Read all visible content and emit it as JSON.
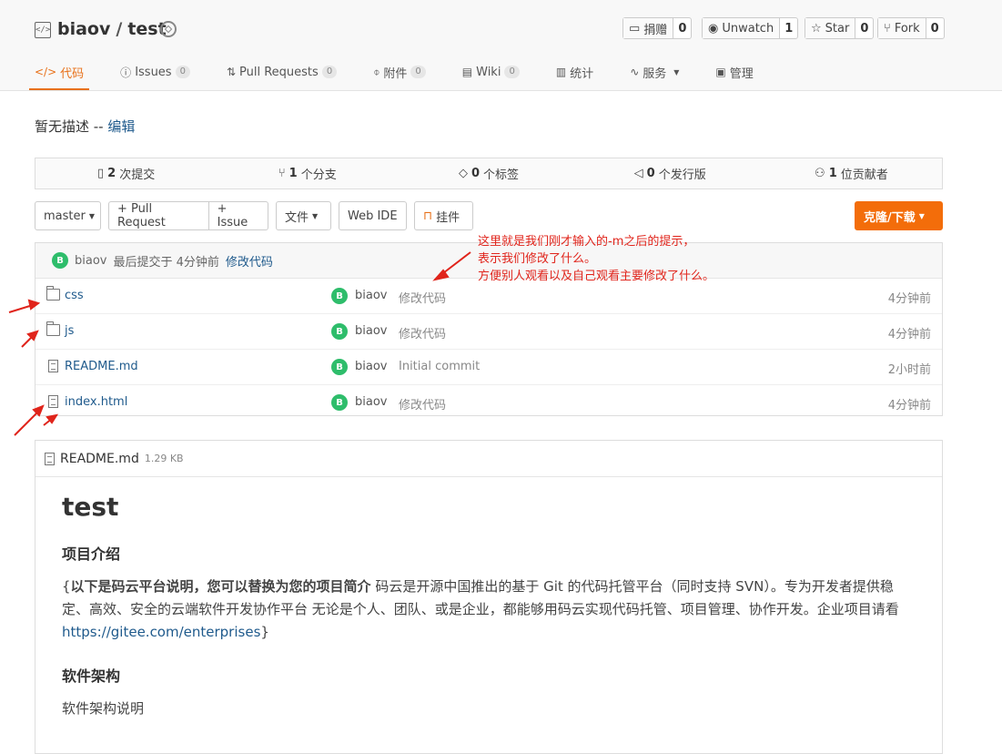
{
  "header": {
    "owner": "biaov",
    "sep": "/",
    "repo": "test",
    "buttons": [
      {
        "label": "捐赠",
        "count": "0"
      },
      {
        "label": "Unwatch",
        "count": "1"
      },
      {
        "label": "Star",
        "count": "0"
      },
      {
        "label": "Fork",
        "count": "0"
      }
    ]
  },
  "tabs": [
    {
      "label": "代码",
      "count": ""
    },
    {
      "label": "Issues",
      "count": "0"
    },
    {
      "label": "Pull Requests",
      "count": "0"
    },
    {
      "label": "附件",
      "count": "0"
    },
    {
      "label": "Wiki",
      "count": "0"
    },
    {
      "label": "统计",
      "count": ""
    },
    {
      "label": "服务",
      "count": ""
    },
    {
      "label": "管理",
      "count": ""
    }
  ],
  "description": {
    "text": "暂无描述 --",
    "edit": "编辑"
  },
  "stats": [
    {
      "num": "2",
      "label": "次提交"
    },
    {
      "num": "1",
      "label": "个分支"
    },
    {
      "num": "0",
      "label": "个标签"
    },
    {
      "num": "0",
      "label": "个发行版"
    },
    {
      "num": "1",
      "label": "位贡献者"
    }
  ],
  "toolbar": {
    "branch": "master",
    "pull_request": "+ Pull Request",
    "issue": "+ Issue",
    "files": "文件",
    "webide": "Web IDE",
    "widget": "挂件",
    "clone": "克隆/下载"
  },
  "last_commit": {
    "avatar": "B",
    "author": "biaov",
    "text": "最后提交于 4分钟前",
    "message": "修改代码"
  },
  "files": [
    {
      "type": "folder",
      "name": "css",
      "author": "biaov",
      "message": "修改代码",
      "time": "4分钟前"
    },
    {
      "type": "folder",
      "name": "js",
      "author": "biaov",
      "message": "修改代码",
      "time": "4分钟前"
    },
    {
      "type": "file",
      "name": "README.md",
      "author": "biaov",
      "message": "Initial commit",
      "time": "2小时前"
    },
    {
      "type": "file",
      "name": "index.html",
      "author": "biaov",
      "message": "修改代码",
      "time": "4分钟前"
    }
  ],
  "annotation": {
    "line1": "这里就是我们刚才输入的-m之后的提示，",
    "line2": "表示我们修改了什么。",
    "line3": "方便别人观看以及自己观看主要修改了什么。",
    "color": "#e0241b"
  },
  "readme": {
    "filename": "README.md",
    "size": "1.29 KB",
    "title": "test",
    "h_intro": "项目介绍",
    "intro_bold": "以下是码云平台说明，您可以替换为您的项目简介",
    "intro_open": "{",
    "intro_text": " 码云是开源中国推出的基于 Git 的代码托管平台（同时支持 SVN）。专为开发者提供稳定、高效、安全的云端软件开发协作平台 无论是个人、团队、或是企业，都能够用码云实现代码托管、项目管理、协作开发。企业项目请看 ",
    "intro_link": "https://gitee.com/enterprises",
    "intro_close": "}",
    "h_arch": "软件架构",
    "arch_text": "软件架构说明"
  },
  "colors": {
    "accent": "#e8711a",
    "clone": "#f36d0a",
    "link": "#1f5a8c",
    "avatar": "#2ebd6b"
  }
}
